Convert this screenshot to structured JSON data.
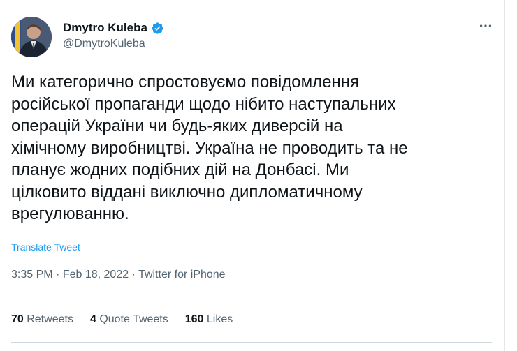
{
  "author": {
    "name": "Dmytro Kuleba",
    "handle": "@DmytroKuleba",
    "verified_color": "#1d9bf0"
  },
  "more_icon": "more-horizontal-icon",
  "tweet": {
    "text": "Ми категорично спростовуємо повідомлення\nросійської пропаганди щодо нібито наступальних\nоперацій України чи будь-яких диверсій на\nхімічному виробництві. Україна не проводить та не\nпланує жодних подібних дій на Донбасі. Ми\nцілковито віддані виключно дипломатичному\nврегулюванню.",
    "translate_label": "Translate Tweet",
    "time": "3:35 PM",
    "date": "Feb 18, 2022",
    "source": "Twitter for iPhone"
  },
  "stats": {
    "retweets_count": "70",
    "retweets_label": "Retweets",
    "quotes_count": "4",
    "quotes_label": "Quote Tweets",
    "likes_count": "160",
    "likes_label": "Likes"
  },
  "colors": {
    "link": "#1d9bf0",
    "secondary": "#536471",
    "primary": "#0f1419"
  }
}
